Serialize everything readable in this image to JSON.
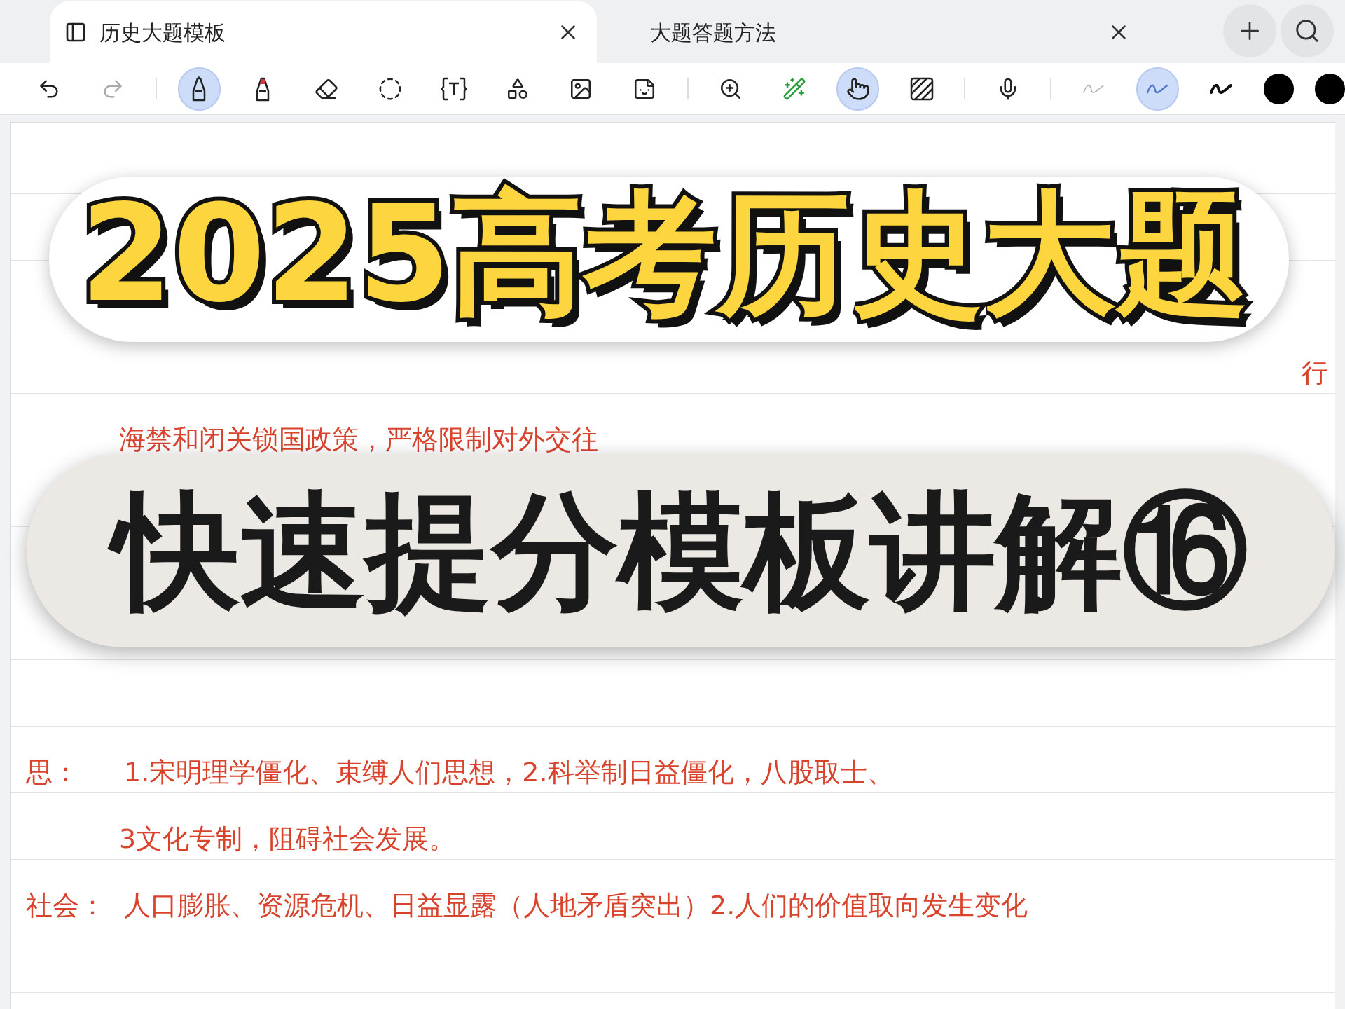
{
  "tabs": [
    {
      "label": "历史大题模板",
      "selected": true
    },
    {
      "label": "大题答题方法",
      "selected": false
    }
  ],
  "toolbar": [
    {
      "kind": "undo",
      "selected": false
    },
    {
      "kind": "redo",
      "selected": false
    },
    {
      "kind": "divider"
    },
    {
      "kind": "pen",
      "selected": true
    },
    {
      "kind": "highlighter",
      "selected": false
    },
    {
      "kind": "eraser",
      "selected": false
    },
    {
      "kind": "lasso",
      "selected": false
    },
    {
      "kind": "text",
      "selected": false
    },
    {
      "kind": "shapes",
      "selected": false
    },
    {
      "kind": "image",
      "selected": false
    },
    {
      "kind": "sticker",
      "selected": false
    },
    {
      "kind": "divider"
    },
    {
      "kind": "zoom",
      "selected": false
    },
    {
      "kind": "laser",
      "selected": false
    },
    {
      "kind": "touch",
      "selected": true
    },
    {
      "kind": "pattern",
      "selected": false
    },
    {
      "kind": "divider"
    },
    {
      "kind": "mic",
      "selected": false
    },
    {
      "kind": "divider"
    },
    {
      "kind": "stroke-thin",
      "selected": false
    },
    {
      "kind": "stroke-medium",
      "selected": true
    },
    {
      "kind": "stroke-thick",
      "selected": false
    },
    {
      "kind": "color",
      "color": "#000000"
    },
    {
      "kind": "color",
      "color": "#000000"
    }
  ],
  "notes": [
    {
      "text": "海禁和闭关锁国政策，严格限制对外交往"
    },
    {
      "label": "思：",
      "text": "1.宋明理学僵化、束缚人们思想，2.科举制日益僵化，八股取士、"
    },
    {
      "text": "3文化专制，阻碍社会发展。"
    },
    {
      "label": "社会：",
      "text": "人口膨胀、资源危机、日益显露（人地矛盾突出）2.人们的价值取向发生变化"
    }
  ],
  "edge_fragment": "行",
  "banner_top": "2025高考历史大题",
  "banner_bottom": "快速提分模板讲解⑯"
}
